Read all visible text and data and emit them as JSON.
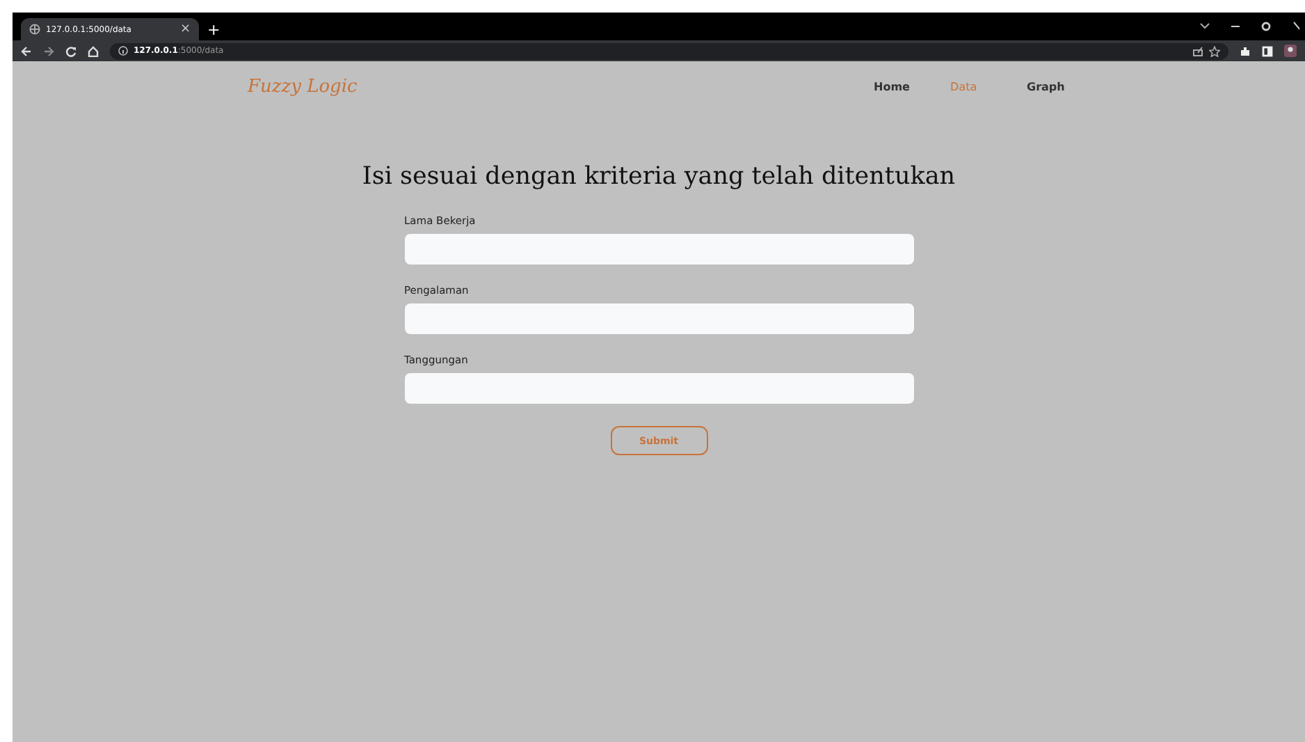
{
  "browser": {
    "tab_title": "127.0.0.1:5000/data",
    "tab_close": "×",
    "new_tab": "+",
    "url_host": "127.0.0.1",
    "url_path": ":5000/data"
  },
  "navbar": {
    "brand": "Fuzzy Logic",
    "links": [
      {
        "label": "Home",
        "selected": false
      },
      {
        "label": "Data",
        "selected": true
      },
      {
        "label": "Graph",
        "selected": false
      }
    ]
  },
  "heading": "Isi sesuai dengan kriteria yang telah ditentukan",
  "form": {
    "fields": [
      {
        "label": "Lama Bekerja"
      },
      {
        "label": "Pengalaman"
      },
      {
        "label": "Tanggungan"
      }
    ],
    "submit": "Submit"
  }
}
